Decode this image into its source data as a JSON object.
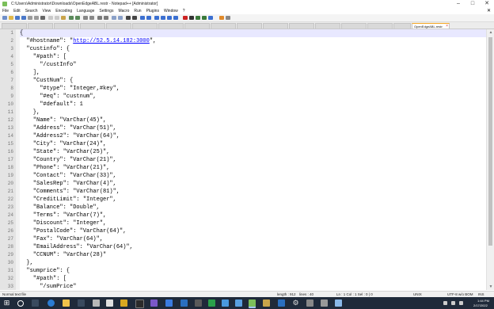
{
  "window": {
    "title": "C:\\Users\\Administrator\\Downloads\\OpenEdgeABL.restr - Notepad++ [Administrator]"
  },
  "menu": [
    "File",
    "Edit",
    "Search",
    "View",
    "Encoding",
    "Language",
    "Settings",
    "Macro",
    "Run",
    "Plugins",
    "Window",
    "?"
  ],
  "tabs": {
    "active_label": "OpenEdgeABL.restr"
  },
  "editor": {
    "lines": [
      "{",
      "  \"#hostname\": \"http://52.5.14.182:3000\",",
      "  \"custinfo\": {",
      "    \"#path\": [",
      "      \"/custInfo\"",
      "    ],",
      "    \"CustNum\": {",
      "      \"#type\": \"Integer,#key\",",
      "      \"#eq\": \"custnum\",",
      "      \"#default\": 1",
      "    },",
      "    \"Name\": \"VarChar(45)\",",
      "    \"Address\": \"VarChar(51)\",",
      "    \"Address2\": \"VarChar(64)\",",
      "    \"City\": \"VarChar(24)\",",
      "    \"State\": \"VarChar(25)\",",
      "    \"Country\": \"VarChar(21)\",",
      "    \"Phone\": \"VarChar(21)\",",
      "    \"Contact\": \"VarChar(33)\",",
      "    \"SalesRep\": \"VarChar(4)\",",
      "    \"Comments\": \"VarChar(81)\",",
      "    \"CreditLimit\": \"Integer\",",
      "    \"Balance\": \"Double\",",
      "    \"Terms\": \"VarChar(7)\",",
      "    \"Discount\": \"Integer\",",
      "    \"PostalCode\": \"VarChar(64)\",",
      "    \"Fax\": \"VarChar(64)\",",
      "    \"EmailAddress\": \"VarChar(64)\",",
      "    \"CCNUM\": \"VarChar(28)\"",
      "  },",
      "  \"sumprice\": {",
      "    \"#path\": [",
      "      \"/sumPrice\""
    ],
    "url_text": "http://52.5.14.182:3000"
  },
  "status": {
    "file_type": "Normal text file",
    "length": "length : 912",
    "lines": "lines : 40",
    "position": "Ln : 1    Col : 1    Sel : 0 | 0",
    "eol": "UNIX",
    "encoding": "UTF-8 w/o BOM",
    "mode": "INS"
  },
  "clock": {
    "time": "1:44 PM",
    "date": "2/17/2022"
  },
  "colors": {
    "taskbar_bg": "#1f2a3a",
    "gutter_bg": "#e4e4e4",
    "url": "#0000ff",
    "tab_active_accent": "#f5a623"
  }
}
